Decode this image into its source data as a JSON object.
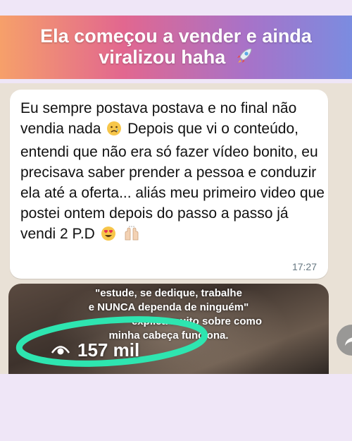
{
  "banner": {
    "title": "Ela começou a vender e ainda viralizou haha",
    "rocket_icon": "rocket-icon"
  },
  "message": {
    "line1": "Eu sempre postava postava e no final não vendia nada",
    "line2": "Depois que vi o conteúdo, entendi que não era só fazer vídeo bonito, eu precisava saber prender a pessoa e conduzir ela até a oferta... aliás meu primeiro video que postei ontem depois do passo a passo já vendi 2 P.D",
    "time": "17:27",
    "emoji_sad": "sad-face-icon",
    "emoji_love": "heart-eyes-icon",
    "emoji_hands": "raised-hands-icon"
  },
  "video": {
    "caption_1": "\"estude, se dedique, trabalhe",
    "caption_2": "e NUNCA dependa de ninguém\"",
    "caption_3": "explica muito sobre como",
    "caption_4": "minha cabeça funciona.",
    "views": "157 mil"
  },
  "colors": {
    "ring": "#2ee5b0",
    "bubble": "#ffffff",
    "time": "#667781"
  }
}
